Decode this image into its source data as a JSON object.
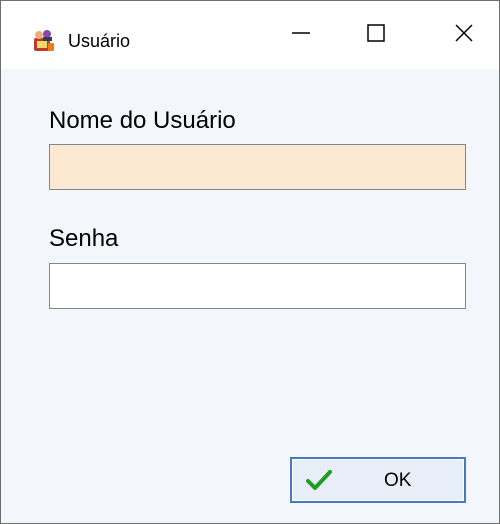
{
  "window": {
    "title": "Usuário",
    "icon": "app-icon",
    "controls": {
      "minimize_icon": "minimize-icon",
      "maximize_icon": "maximize-icon",
      "close_icon": "close-icon"
    }
  },
  "form": {
    "username": {
      "label": "Nome do Usuário",
      "value": "",
      "background": "#fde8d2"
    },
    "password": {
      "label": "Senha",
      "value": "",
      "background": "#ffffff"
    },
    "ok_button": {
      "label": "OK",
      "icon": "checkmark-icon",
      "accent": "#1f9e1f"
    }
  }
}
